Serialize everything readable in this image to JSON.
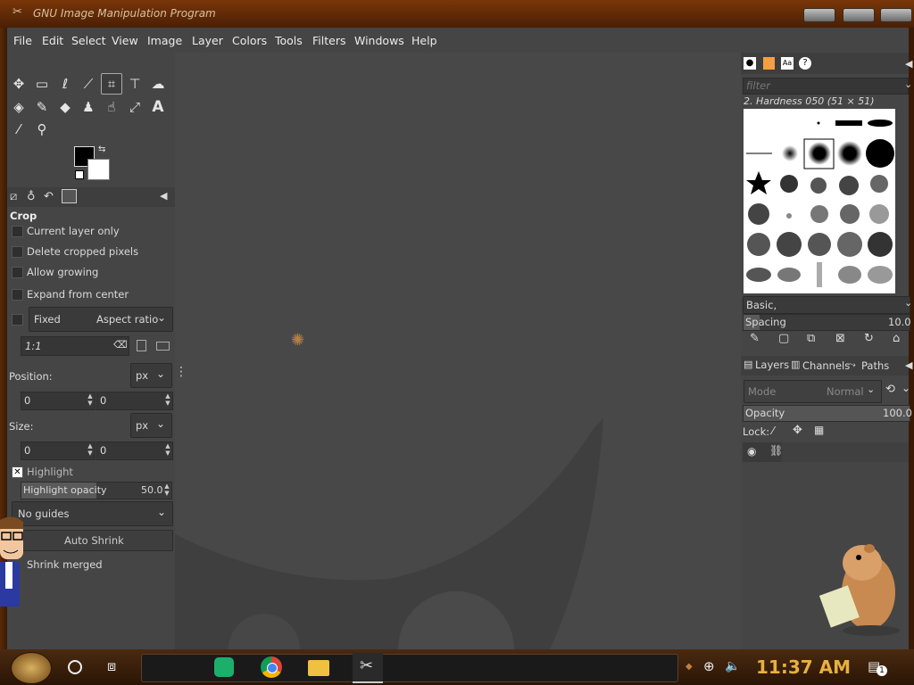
{
  "window": {
    "title": "GNU Image Manipulation Program"
  },
  "menubar": [
    "File",
    "Edit",
    "Select",
    "View",
    "Image",
    "Layer",
    "Colors",
    "Tools",
    "Filters",
    "Windows",
    "Help"
  ],
  "tool_options": {
    "title": "Crop",
    "current_layer_only": "Current layer only",
    "delete_cropped_pixels": "Delete cropped pixels",
    "allow_growing": "Allow growing",
    "expand_from_center": "Expand from center",
    "fixed_label": "Fixed",
    "fixed_mode": "Aspect ratio",
    "ratio_value": "1:1",
    "position_label": "Position:",
    "position_unit": "px",
    "position_x": "0",
    "position_y": "0",
    "size_label": "Size:",
    "size_unit": "px",
    "size_x": "0",
    "size_y": "0",
    "highlight_label": "Highlight",
    "highlight_opacity_label": "Highlight opacity",
    "highlight_opacity_value": "50.0",
    "guides_value": "No guides",
    "auto_shrink": "Auto Shrink",
    "shrink_merged": "Shrink merged"
  },
  "brushes": {
    "filter_placeholder": "filter",
    "current_brush": "2. Hardness 050 (51 × 51)",
    "tag": "Basic,",
    "spacing_label": "Spacing",
    "spacing_value": "10.0"
  },
  "layers": {
    "tabs": [
      "Layers",
      "Channels",
      "Paths"
    ],
    "mode_label": "Mode",
    "mode_value": "Normal",
    "opacity_label": "Opacity",
    "opacity_value": "100.0",
    "lock_label": "Lock:"
  },
  "taskbar": {
    "clock": "11:37 AM",
    "notification_count": "1"
  },
  "colors": {
    "accent_clock": "#e8b040",
    "titlebar": "#7a3608"
  }
}
